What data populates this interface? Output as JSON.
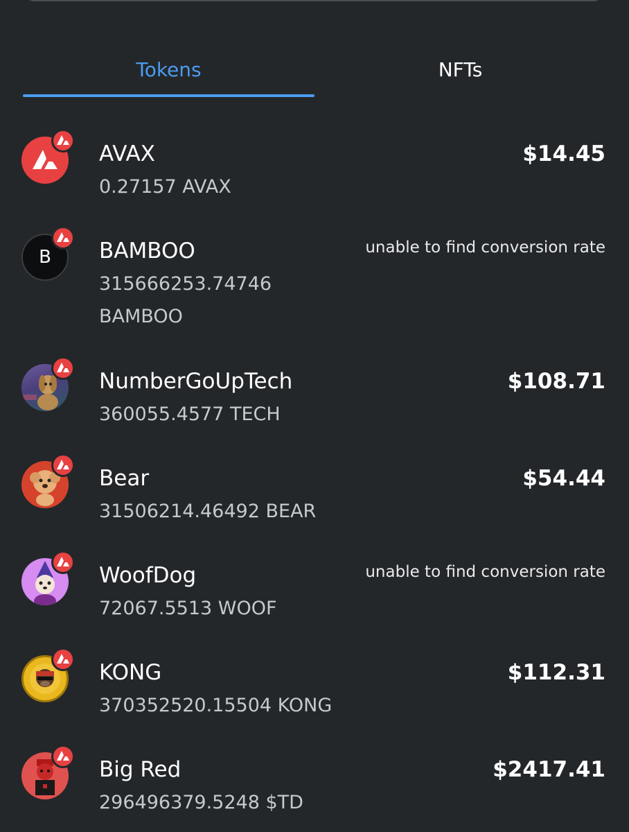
{
  "tabs": [
    {
      "label": "Tokens",
      "active": true
    },
    {
      "label": "NFTs",
      "active": false
    }
  ],
  "accent_color": "#4b9cf0",
  "network_badge": {
    "icon": "avalanche-icon",
    "color": "#e84142"
  },
  "tokens": [
    {
      "name": "AVAX",
      "balance": "0.27157 AVAX",
      "value": "$14.45",
      "icon": "avax-logo-icon"
    },
    {
      "name": "BAMBOO",
      "balance": "315666253.74746 BAMBOO",
      "value": "unable to find conversion rate",
      "icon": "letter-avatar-icon",
      "initial": "B"
    },
    {
      "name": "NumberGoUpTech",
      "balance": "360055.4577 TECH",
      "value": "$108.71",
      "icon": "dog-avatar-icon"
    },
    {
      "name": "Bear",
      "balance": "31506214.46492 BEAR",
      "value": "$54.44",
      "icon": "bear-dog-avatar-icon"
    },
    {
      "name": "WoofDog",
      "balance": "72067.5513 WOOF",
      "value": "unable to find conversion rate",
      "icon": "wizard-dog-avatar-icon"
    },
    {
      "name": "KONG",
      "balance": "370352520.15504 KONG",
      "value": "$112.31",
      "icon": "kong-coin-icon"
    },
    {
      "name": "Big Red",
      "balance": "296496379.5248 $TD",
      "value": "$2417.41",
      "icon": "big-red-avatar-icon"
    }
  ]
}
